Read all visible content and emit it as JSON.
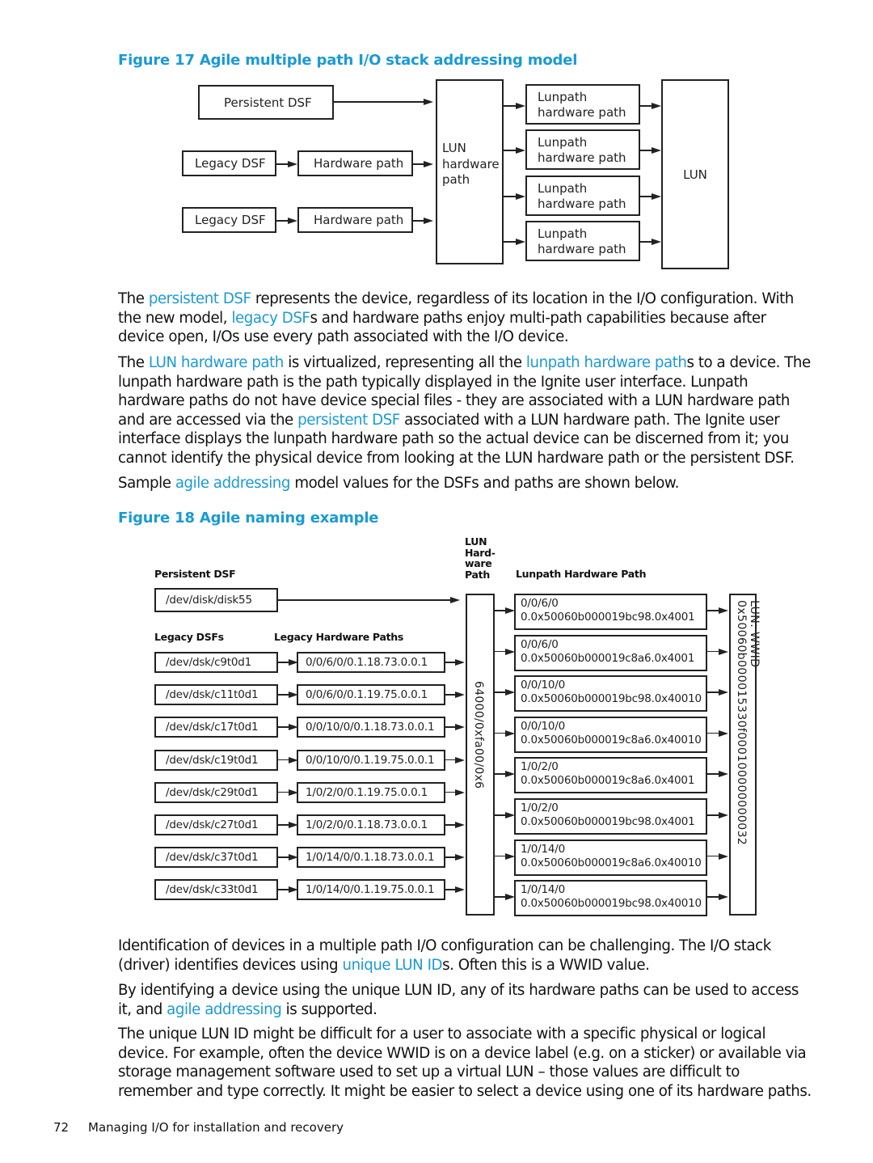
{
  "figure17": {
    "title": "Figure 17 Agile multiple path I/O stack addressing model",
    "persistent_dsf": "Persistent DSF",
    "legacy_rows": [
      {
        "dsf": "Legacy DSF",
        "hw": "Hardware path"
      },
      {
        "dsf": "Legacy DSF",
        "hw": "Hardware path"
      }
    ],
    "lun_hw_path": [
      "LUN",
      "hardware",
      "path"
    ],
    "lunpaths": [
      [
        "Lunpath",
        "hardware path"
      ],
      [
        "Lunpath",
        "hardware path"
      ],
      [
        "Lunpath",
        "hardware path"
      ],
      [
        "Lunpath",
        "hardware path"
      ]
    ],
    "lun": "LUN"
  },
  "para1": {
    "t1": "The ",
    "l1": "persistent DSF",
    "t2": " represents the device, regardless of its location in the I/O configuration. With the new model, ",
    "l2": "legacy DSF",
    "t3": "s and hardware paths enjoy multi-path capabilities because after device open, I/Os use every path associated with the I/O device."
  },
  "para2": {
    "t1": "The ",
    "l1": "LUN hardware path",
    "t2": " is virtualized, representing all the ",
    "l2": "lunpath hardware path",
    "t3": "s to a device. The lunpath hardware path is the path typically displayed in the Ignite user interface. Lunpath hardware paths do not have device special files - they are associated with a LUN hardware path and are accessed via the ",
    "l3": "persistent DSF",
    "t4": " associated with a LUN hardware path. The Ignite user interface displays the lunpath hardware path so the actual device can be discerned from it; you cannot identify the physical device from looking at the LUN hardware path or the persistent DSF."
  },
  "para3": {
    "t1": "Sample ",
    "l1": "agile addressing",
    "t2": " model values for the DSFs and paths are shown below."
  },
  "figure18": {
    "title": "Figure 18 Agile naming example",
    "headers": {
      "persistent_dsf": "Persistent DSF",
      "legacy_dsfs": "Legacy DSFs",
      "legacy_hw_paths": "Legacy Hardware Paths",
      "lun_hw_path": [
        "LUN",
        "Hard-",
        "ware",
        "Path"
      ],
      "lunpath_hw_path": "Lunpath Hardware Path"
    },
    "persistent_dsf_value": "/dev/disk/disk55",
    "legacy": [
      {
        "dsf": "/dev/dsk/c9t0d1",
        "hw": "0/0/6/0/0.1.18.73.0.0.1"
      },
      {
        "dsf": "/dev/dsk/c11t0d1",
        "hw": "0/0/6/0/0.1.19.75.0.0.1"
      },
      {
        "dsf": "/dev/dsk/c17t0d1",
        "hw": "0/0/10/0/0.1.18.73.0.0.1"
      },
      {
        "dsf": "/dev/dsk/c19t0d1",
        "hw": "0/0/10/0/0.1.19.75.0.0.1"
      },
      {
        "dsf": "/dev/dsk/c29t0d1",
        "hw": "1/0/2/0/0.1.19.75.0.0.1"
      },
      {
        "dsf": "/dev/dsk/c27t0d1",
        "hw": "1/0/2/0/0.1.18.73.0.0.1"
      },
      {
        "dsf": "/dev/dsk/c37t0d1",
        "hw": "1/0/14/0/0.1.18.73.0.0.1"
      },
      {
        "dsf": "/dev/dsk/c33t0d1",
        "hw": "1/0/14/0/0.1.19.75.0.0.1"
      }
    ],
    "lun_hw_path_value": "64000/0xfa00/0x6",
    "lunpaths": [
      {
        "hba": "0/0/6/0",
        "tgt": "0.0x50060b000019bc98.0x4001"
      },
      {
        "hba": "0/0/6/0",
        "tgt": "0.0x50060b000019c8a6.0x4001"
      },
      {
        "hba": "0/0/10/0",
        "tgt": "0.0x50060b000019bc98.0x40010"
      },
      {
        "hba": "0/0/10/0",
        "tgt": "0.0x50060b000019c8a6.0x40010"
      },
      {
        "hba": "1/0/2/0",
        "tgt": "0.0x50060b000019c8a6.0x4001"
      },
      {
        "hba": "1/0/2/0",
        "tgt": "0.0x50060b000019bc98.0x4001"
      },
      {
        "hba": "1/0/14/0",
        "tgt": "0.0x50060b000019c8a6.0x40010"
      },
      {
        "hba": "1/0/14/0",
        "tgt": "0.0x50060b000019bc98.0x40010"
      }
    ],
    "lun_wwid": "LUN: WWID 0x50060b000015330f000100000000032"
  },
  "para4": {
    "t1": "Identification of devices in a multiple path I/O configuration can be challenging. The I/O stack (driver) identifies devices using ",
    "l1": "unique LUN ID",
    "t2": "s. Often this is a WWID value."
  },
  "para5": {
    "t1": "By identifying a device using the unique LUN ID, any of its hardware paths can be used to access it, and ",
    "l1": "agile addressing",
    "t2": " is supported."
  },
  "para6": {
    "t1": "The unique LUN ID might be difficult for a user to associate with a specific physical or logical device. For example, often the device WWID is on a device label (e.g. on a sticker) or available via storage management software used to set up a virtual LUN – those values are difficult to remember and type correctly. It might be easier to select a device using one of its hardware paths."
  },
  "footer": {
    "page_number": "72",
    "section": "Managing I/O for installation and recovery"
  }
}
